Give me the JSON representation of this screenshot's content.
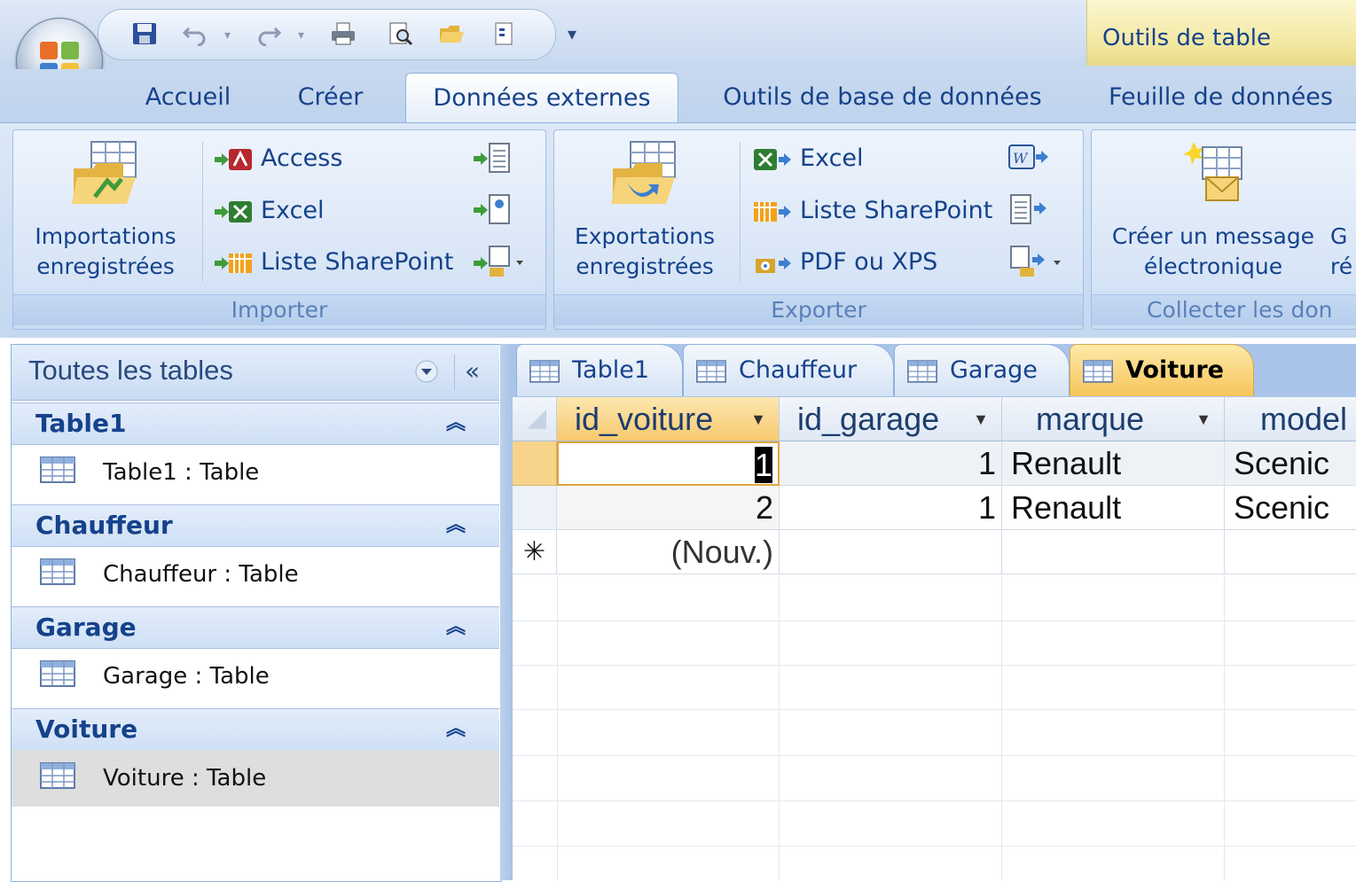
{
  "quick_access": {
    "icons": [
      "save-icon",
      "undo-icon",
      "redo-icon",
      "print-icon",
      "print-preview-icon",
      "open-folder-icon",
      "document-icon",
      "customize-arrow-icon"
    ]
  },
  "context_tab": {
    "title": "Outils de table"
  },
  "ribbon_tabs": [
    "Accueil",
    "Créer",
    "Données externes",
    "Outils de base de données",
    "Feuille de données"
  ],
  "active_ribbon_tab": "Données externes",
  "groups": {
    "importer": {
      "label": "Importer",
      "big_button": {
        "line1": "Importations",
        "line2": "enregistrées"
      },
      "items": [
        "Access",
        "Excel",
        "Liste SharePoint"
      ]
    },
    "exporter": {
      "label": "Exporter",
      "big_button": {
        "line1": "Exportations",
        "line2": "enregistrées"
      },
      "items": [
        "Excel",
        "Liste SharePoint",
        "PDF ou XPS"
      ]
    },
    "collecter": {
      "label": "Collecter les don",
      "big_button": {
        "line1": "Créer un message",
        "line2": "électronique"
      },
      "cut_button": {
        "line1": "G",
        "line2": "ré"
      }
    }
  },
  "nav": {
    "title": "Toutes les tables",
    "collapse": "«",
    "groups": [
      {
        "name": "Table1",
        "item": "Table1 : Table"
      },
      {
        "name": "Chauffeur",
        "item": "Chauffeur : Table"
      },
      {
        "name": "Garage",
        "item": "Garage : Table"
      },
      {
        "name": "Voiture",
        "item": "Voiture : Table"
      }
    ]
  },
  "doc_tabs": [
    "Table1",
    "Chauffeur",
    "Garage",
    "Voiture"
  ],
  "active_doc_tab": "Voiture",
  "datasheet": {
    "columns": [
      "id_voiture",
      "id_garage",
      "marque",
      "model"
    ],
    "rows": [
      {
        "id_voiture": "1",
        "id_garage": "1",
        "marque": "Renault",
        "model": "Scenic"
      },
      {
        "id_voiture": "2",
        "id_garage": "1",
        "marque": "Renault",
        "model": "Scenic"
      }
    ],
    "new_row_marker": "✳",
    "new_row_label": "(Nouv.)"
  },
  "colors": {
    "accent": "#15428b",
    "active_tab": "#f7c55b",
    "ribbon": "#c4d8f0"
  }
}
